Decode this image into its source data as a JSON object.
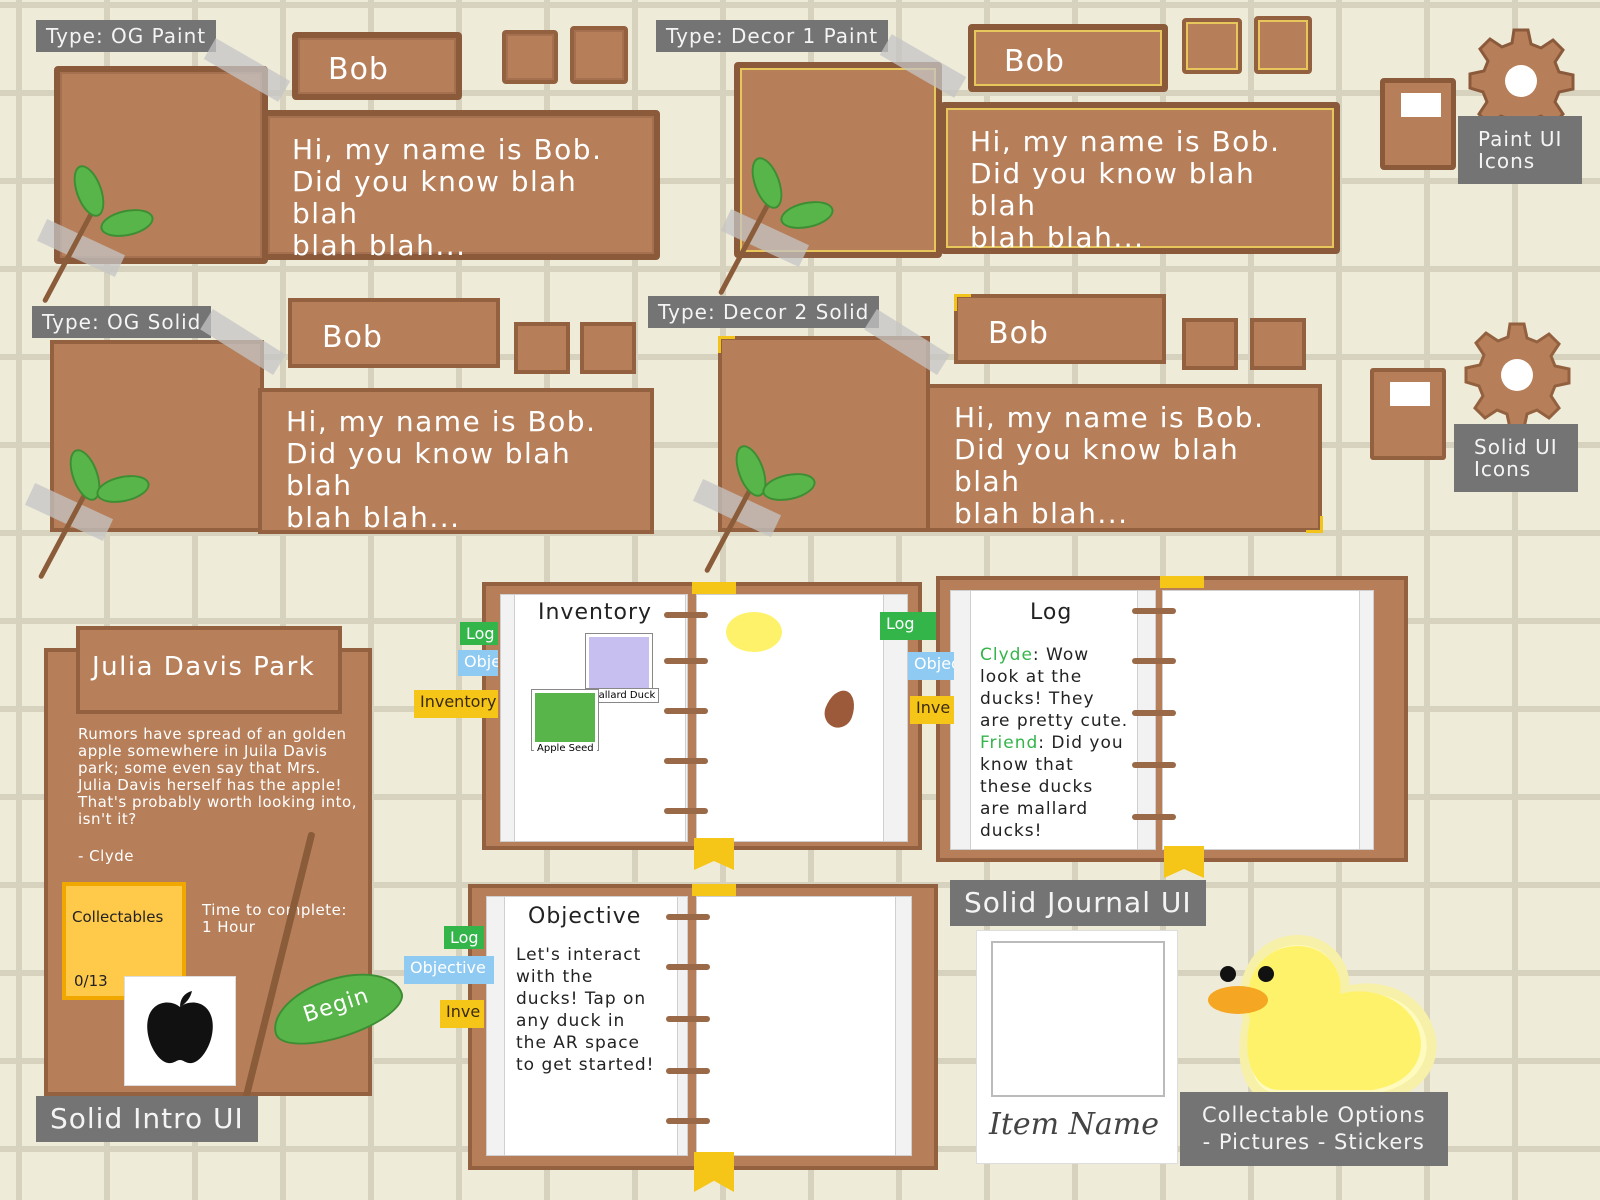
{
  "labels": {
    "og_paint": "Type: OG Paint",
    "decor1_paint": "Type: Decor 1 Paint",
    "og_solid": "Type: OG Solid",
    "decor2_solid": "Type: Decor 2 Solid",
    "paint_icons": "Paint UI\nIcons",
    "solid_icons": "Solid UI\nIcons",
    "solid_journal": "Solid Journal UI",
    "solid_intro": "Solid Intro UI",
    "collectable_options": "Collectable Options\n- Pictures - Stickers"
  },
  "dialogue": {
    "speaker": "Bob",
    "text": "Hi, my name is Bob.\nDid you know blah blah\nblah blah..."
  },
  "intro": {
    "park_name": "Julia Davis Park",
    "description": "Rumors have spread of an golden apple somewhere in Juila Davis park; some even say that Mrs. Julia Davis herself has the apple! That's probably worth looking into, isn't it?",
    "signature": "- Clyde",
    "collectables_label": "Collectables",
    "collectables_count": "0/13",
    "time_label": "Time to complete:\n1 Hour",
    "begin_button": "Begin"
  },
  "journal_tabs": {
    "log": "Log",
    "objective": "Objective",
    "objective_short": "Objec",
    "inventory": "Inventory",
    "inventory_short": "Inve"
  },
  "inventory_page": {
    "title": "Inventory",
    "item1": "Mallard Duck",
    "item2": "Apple Seed"
  },
  "log_page": {
    "title": "Log",
    "speaker1": "Clyde",
    "line1": ": Wow look at the ducks! They are pretty cute.",
    "speaker2": "Friend",
    "line2": ": Did you know that these ducks are mallard ducks!"
  },
  "objective_page": {
    "title": "Objective",
    "text": "Let's interact with the ducks! Tap on any duck in the AR space to get started!"
  },
  "collectable_card": {
    "caption": "Item Name"
  },
  "colors": {
    "wood": "#b67f5a",
    "wood_border": "#93613f",
    "label_gray": "#747474",
    "accent_yellow": "#f5c518",
    "tab_green": "#33b54a",
    "tab_blue": "#8fcaf2",
    "leaf_green": "#58b54a"
  }
}
